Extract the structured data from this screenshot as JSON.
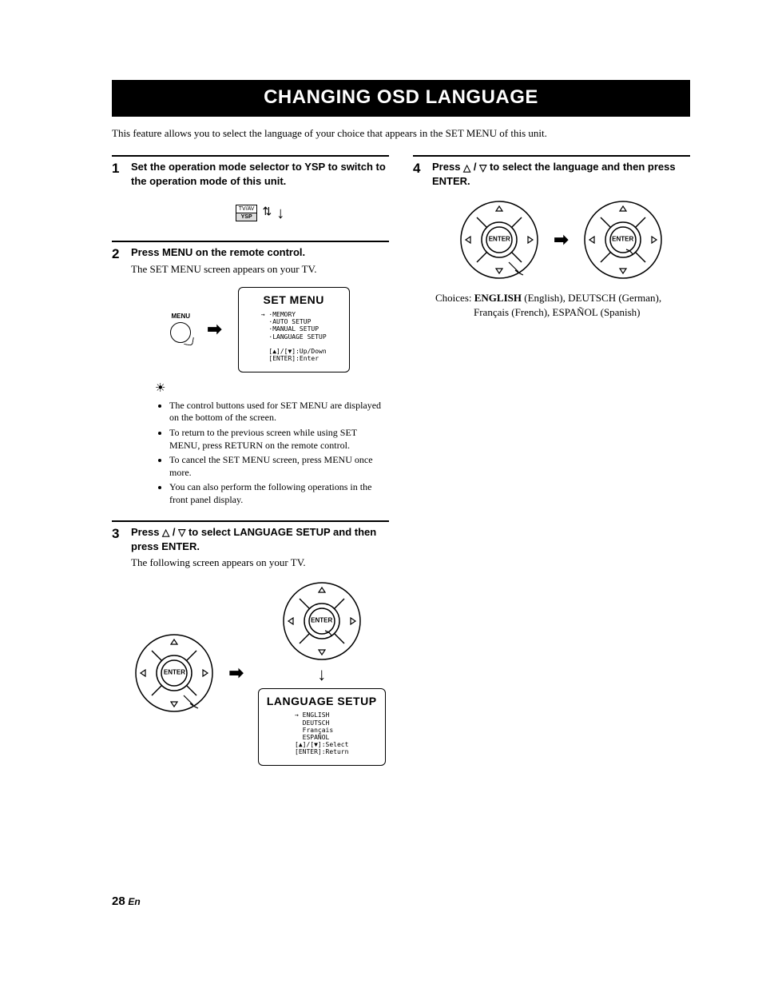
{
  "title": "CHANGING OSD LANGUAGE",
  "intro": "This feature allows you to select the language of your choice that appears in the SET MENU of this unit.",
  "steps": {
    "s1": {
      "num": "1",
      "head": "Set the operation mode selector to YSP to switch to the operation mode of this unit.",
      "switch_top": "TV/AV",
      "switch_bottom": "YSP"
    },
    "s2": {
      "num": "2",
      "head": "Press MENU on the remote control.",
      "sub": "The SET MENU screen appears on your TV.",
      "menu_label": "MENU",
      "screen_title": "SET MENU",
      "screen_body": "→ ·MEMORY\n  ·AUTO SETUP\n  ·MANUAL SETUP\n  ·LANGUAGE SETUP\n\n  [▲]/[▼]:Up/Down\n  [ENTER]:Enter",
      "tips": [
        "The control buttons used for SET MENU are displayed on the bottom of the screen.",
        "To return to the previous screen while using SET MENU, press RETURN on the remote control.",
        "To cancel the SET MENU screen, press MENU once more.",
        "You can also perform the following operations in the front panel display."
      ]
    },
    "s3": {
      "num": "3",
      "head_pre": "Press ",
      "head_post": " to select LANGUAGE SETUP and then press ENTER.",
      "sub": "The following screen appears on your TV.",
      "screen_title": "LANGUAGE SETUP",
      "screen_body": "→ ENGLISH\n  DEUTSCH\n  Français\n  ESPAÑOL\n[▲]/[▼]:Select\n[ENTER]:Return",
      "enter": "ENTER"
    },
    "s4": {
      "num": "4",
      "head_pre": "Press ",
      "head_post": " to select the language and then press ENTER.",
      "enter": "ENTER",
      "choices_pre": "Choices: ",
      "choices_strong": "ENGLISH",
      "choices_post1": " (English), DEUTSCH (German),",
      "choices_post2": "Français (French), ESPAÑOL (Spanish)"
    }
  },
  "page": {
    "num": "28",
    "lang": "En"
  }
}
